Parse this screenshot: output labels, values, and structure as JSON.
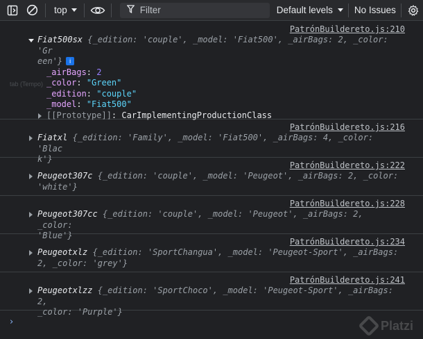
{
  "toolbar": {
    "context": "top",
    "filter_placeholder": "Filter",
    "levels": "Default levels",
    "issues": "No Issues",
    "icons": [
      "sidebar-icon",
      "clear-icon",
      "eye-icon",
      "filter-icon",
      "gear-icon"
    ]
  },
  "ghost_text": "tab (Tempo)",
  "messages": [
    {
      "source": "PatrónBuildereto.js:210",
      "name": "Fiat500sx",
      "preview_l1": " {_edition: 'couple', _model: 'Fiat500', _airBags: 2, _color: 'Gr",
      "preview_l2": "een'}",
      "expanded": true,
      "props": [
        {
          "key": "_airBags",
          "sep": ": ",
          "value": "2",
          "type": "n"
        },
        {
          "key": "_color",
          "sep": ": ",
          "value": "\"Green\"",
          "type": "s"
        },
        {
          "key": "_edition",
          "sep": ": ",
          "value": "\"couple\"",
          "type": "s"
        },
        {
          "key": "_model",
          "sep": ": ",
          "value": "\"Fiat500\"",
          "type": "s"
        }
      ],
      "proto_key": "[[Prototype]]",
      "proto_value": "CarImplementingProductionClass"
    },
    {
      "source": "PatrónBuildereto.js:216",
      "name": "Fiatxl",
      "preview_l1": " {_edition: 'Family', _model: 'Fiat500', _airBags: 4, _color: 'Blac",
      "preview_l2": "k'}"
    },
    {
      "source": "PatrónBuildereto.js:222",
      "name": "Peugeot307c",
      "preview_l1": " {_edition: 'couple', _model: 'Peugeot', _airBags: 2, _color:",
      "preview_l2": "'white'}"
    },
    {
      "source": "PatrónBuildereto.js:228",
      "name": "Peugeot307cc",
      "preview_l1": " {_edition: 'couple', _model: 'Peugeot', _airBags: 2, _color:",
      "preview_l2": "'Blue'}"
    },
    {
      "source": "PatrónBuildereto.js:234",
      "name": "Peugeotxlz",
      "preview_l1": " {_edition: 'SportChangua', _model: 'Peugeot-Sport', _airBags:",
      "preview_l2": "2, _color: 'grey'}"
    },
    {
      "source": "PatrónBuildereto.js:241",
      "name": "Peugeotxlzz",
      "preview_l1": " {_edition: 'SportChoco', _model: 'Peugeot-Sport', _airBags: 2,",
      "preview_l2": "_color: 'Purple'}"
    }
  ],
  "prompt_symbol": "›",
  "watermark": "Platzi"
}
